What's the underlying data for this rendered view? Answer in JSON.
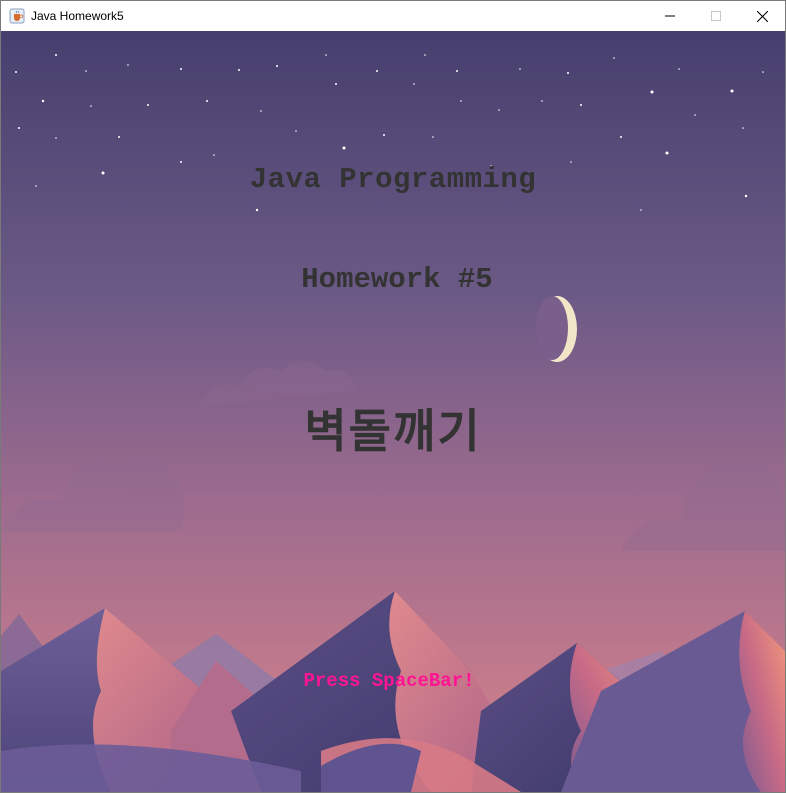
{
  "window": {
    "title": "Java Homework5",
    "icon": "java-coffee-icon",
    "controls": [
      "minimize-icon",
      "maximize-icon",
      "close-icon"
    ]
  },
  "scene": {
    "course_title": "Java Programming",
    "homework_title": "Homework #5",
    "game_title": "벽돌깨기",
    "prompt": "Press SpaceBar!",
    "colors": {
      "sky_top": "#463f6e",
      "sky_bottom": "#c97a8c",
      "title_text": "#333333",
      "prompt_text": "#ff1493",
      "moon": "#f2e6c8"
    }
  }
}
